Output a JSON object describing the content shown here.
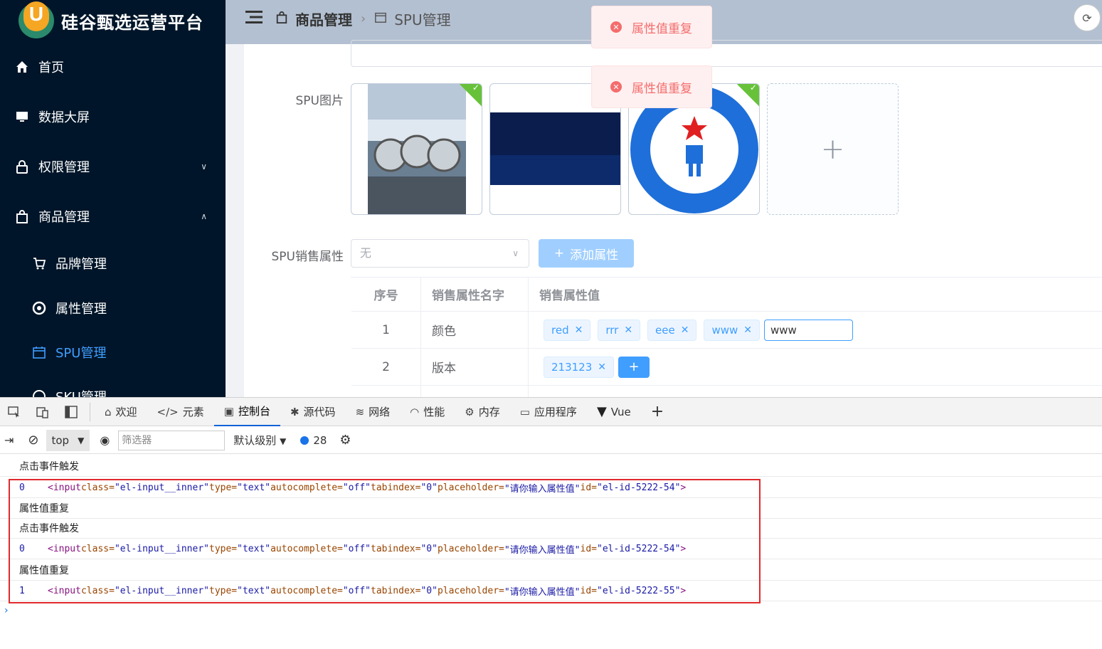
{
  "sidebar": {
    "logo_letter": "U",
    "title": "硅谷甄选运营平台",
    "items": [
      {
        "label": "首页",
        "icon": "home-icon"
      },
      {
        "label": "数据大屏",
        "icon": "monitor-icon"
      },
      {
        "label": "权限管理",
        "icon": "lock-icon"
      },
      {
        "label": "商品管理",
        "icon": "bag-icon"
      },
      {
        "label": "品牌管理",
        "icon": "cart-icon"
      },
      {
        "label": "属性管理",
        "icon": "chrome-icon"
      },
      {
        "label": "SPU管理",
        "icon": "calendar-icon"
      },
      {
        "label": "SKU管理",
        "icon": "basketball-icon"
      }
    ]
  },
  "header": {
    "breadcrumb_1": "商品管理",
    "breadcrumb_2": "SPU管理"
  },
  "form": {
    "spu_images_label": "SPU图片",
    "sale_attr_label": "SPU销售属性",
    "select_value": "无",
    "add_attr_button": "添加属性",
    "table_headers": [
      "序号",
      "销售属性名字",
      "销售属性值"
    ],
    "rows": [
      {
        "index": "1",
        "name": "颜色",
        "values": [
          "red",
          "rrr",
          "eee",
          "www"
        ],
        "input_value": "www"
      },
      {
        "index": "2",
        "name": "版本",
        "values": [
          "213123"
        ]
      }
    ]
  },
  "messages": [
    "属性值重复",
    "属性值重复"
  ],
  "devtools": {
    "tabs": [
      "欢迎",
      "元素",
      "控制台",
      "源代码",
      "网络",
      "性能",
      "内存",
      "应用程序",
      "Vue"
    ],
    "active_tab": "控制台",
    "context": "top",
    "filter_placeholder": "筛选器",
    "level": "默认级别",
    "message_count": "28",
    "logs": [
      {
        "type": "text",
        "text": "点击事件触发"
      },
      {
        "type": "code",
        "index": "0",
        "id": "el-id-5222-54"
      },
      {
        "type": "text",
        "text": "属性值重复"
      },
      {
        "type": "text",
        "text": "点击事件触发"
      },
      {
        "type": "code",
        "index": "0",
        "id": "el-id-5222-54"
      },
      {
        "type": "text",
        "text": "属性值重复"
      },
      {
        "type": "code",
        "index": "1",
        "id": "el-id-5222-55"
      }
    ],
    "code_parts": {
      "open": "<input",
      "class_attr": " class=",
      "class_val": "\"el-input__inner\"",
      "type_attr": " type=",
      "type_val": "\"text\"",
      "ac_attr": " autocomplete=",
      "ac_val": "\"off\"",
      "tab_attr": " tabindex=",
      "tab_val": "\"0\"",
      "ph_attr": " placeholder=",
      "ph_val": "\"请你输入属性值\"",
      "id_attr": " id=",
      "close": ">"
    }
  }
}
